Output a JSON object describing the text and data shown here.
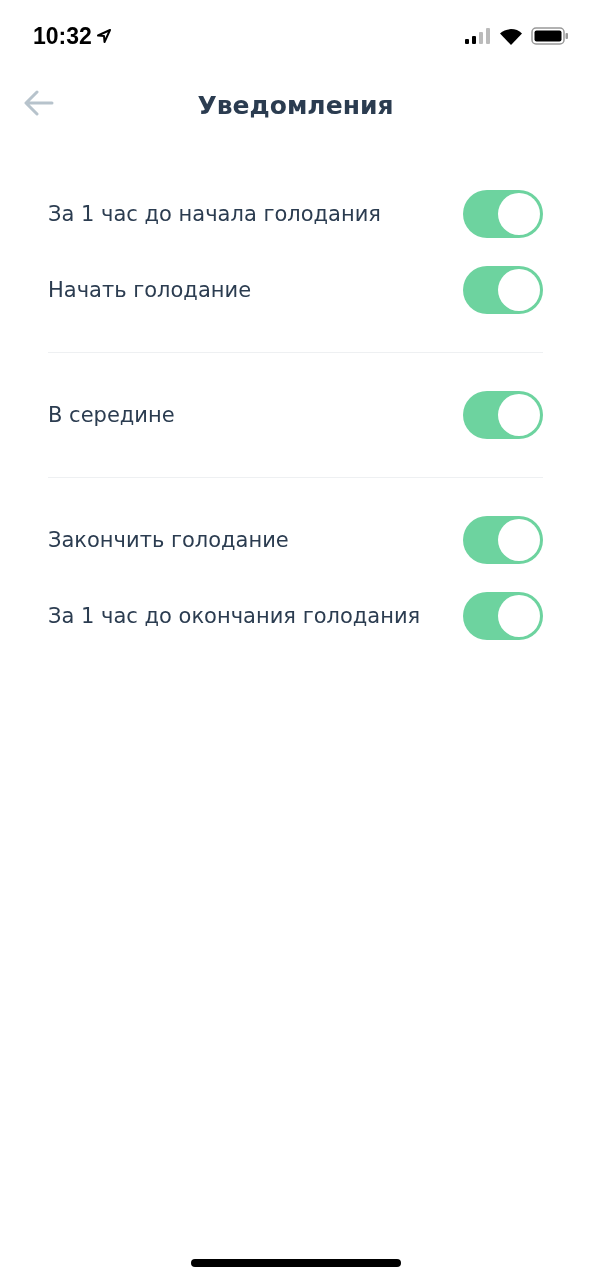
{
  "status_bar": {
    "time": "10:32"
  },
  "header": {
    "title": "Уведомления"
  },
  "groups": [
    {
      "items": [
        {
          "label": "За 1 час до начала голодания",
          "on": true
        },
        {
          "label": "Начать голодание",
          "on": true
        }
      ]
    },
    {
      "items": [
        {
          "label": "В середине",
          "on": true
        }
      ]
    },
    {
      "items": [
        {
          "label": "Закончить голодание",
          "on": true
        },
        {
          "label": "За 1 час до окончания голодания",
          "on": true
        }
      ]
    }
  ]
}
